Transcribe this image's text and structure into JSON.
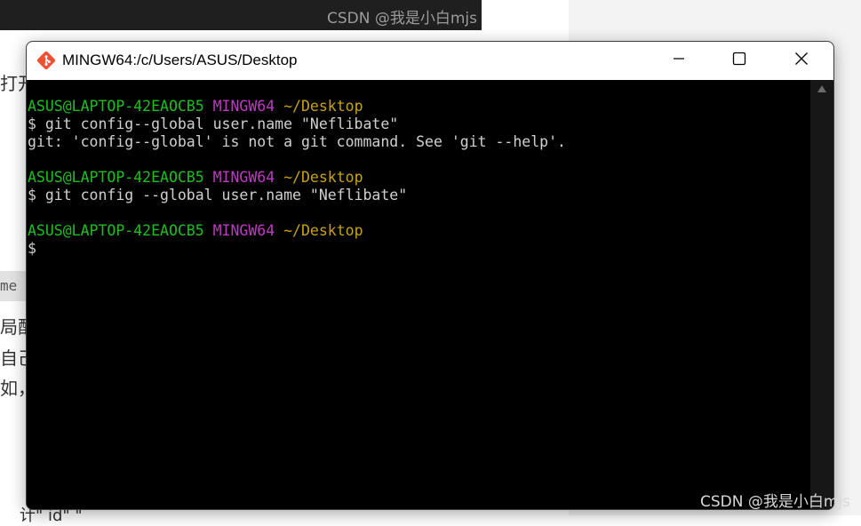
{
  "background": {
    "watermark_top": "CSDN @我是小白mjs",
    "text_lines": [
      "打开",
      "局配",
      "自己",
      "如，"
    ],
    "code_snippet": "me",
    "bottom_text": "计\"            id\"           \""
  },
  "window": {
    "title": "MINGW64:/c/Users/ASUS/Desktop",
    "app_icon": "git-diamond-icon",
    "controls": {
      "minimize": "minimize-icon",
      "maximize": "maximize-icon",
      "close": "close-icon"
    }
  },
  "terminal": {
    "colors": {
      "user": "#1cc01c",
      "system": "#c03ac6",
      "path": "#c9a20f",
      "text": "#d0d0d0",
      "background": "#000000"
    },
    "prompts": [
      {
        "user": "ASUS@LAPTOP-42EAOCB5",
        "system": "MINGW64",
        "path": "~/Desktop"
      },
      {
        "user": "ASUS@LAPTOP-42EAOCB5",
        "system": "MINGW64",
        "path": "~/Desktop"
      },
      {
        "user": "ASUS@LAPTOP-42EAOCB5",
        "system": "MINGW64",
        "path": "~/Desktop"
      }
    ],
    "commands": [
      "$ git config--global user.name \"Neflibate\"",
      "$ git config --global user.name \"Neflibate\"",
      "$"
    ],
    "outputs": [
      "git: 'config--global' is not a git command. See 'git --help'."
    ]
  },
  "watermark_bottom": "CSDN @我是小白mjs"
}
